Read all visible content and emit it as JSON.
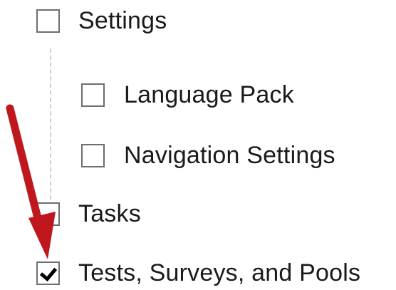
{
  "tree": {
    "items": [
      {
        "label": "Settings",
        "checked": false,
        "level": 0
      },
      {
        "label": "Language Pack",
        "checked": false,
        "level": 1
      },
      {
        "label": "Navigation Settings",
        "checked": false,
        "level": 1
      },
      {
        "label": "Tasks",
        "checked": false,
        "level": 0
      },
      {
        "label": "Tests, Surveys, and Pools",
        "checked": true,
        "level": 0
      }
    ]
  },
  "annotation": {
    "arrow_color": "#c0161d"
  },
  "colors": {
    "checkbox_border": "#6e6e6e",
    "text": "#1a1a1a",
    "tree_line": "#cfcfcf"
  }
}
